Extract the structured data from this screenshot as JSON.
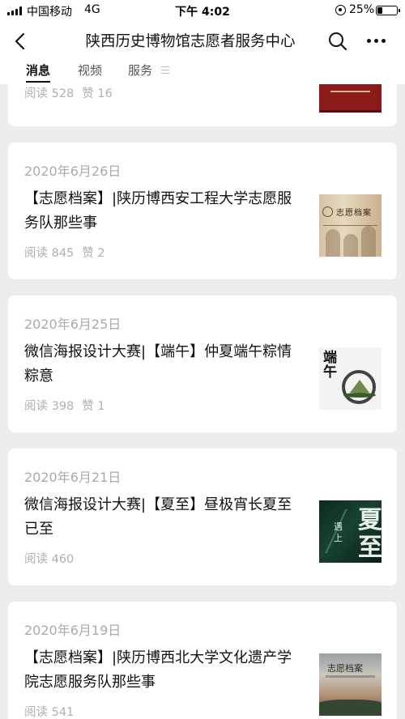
{
  "status_bar": {
    "carrier": "中国移动",
    "network": "4G",
    "time": "下午 4:02",
    "battery_percent": "25%",
    "battery_level": 0.25
  },
  "nav": {
    "title": "陕西历史博物馆志愿者服务中心",
    "back_icon": "chevron-left-icon",
    "search_icon": "search-icon",
    "more_icon": "more-dots-icon"
  },
  "tabs": [
    {
      "label": "消息",
      "active": true
    },
    {
      "label": "视频",
      "active": false
    },
    {
      "label": "服务",
      "active": false
    }
  ],
  "articles": [
    {
      "date": "",
      "title": "",
      "reads": "阅读 528",
      "likes": "赞 16"
    },
    {
      "date": "2020年6月26日",
      "title": "【志愿档案】|陕历博西安工程大学志愿服务队那些事",
      "reads": "阅读 845",
      "likes": "赞 2",
      "thumb_text": "志愿档案"
    },
    {
      "date": "2020年6月25日",
      "title": "微信海报设计大赛|【端午】仲夏端午粽情粽意",
      "reads": "阅读 398",
      "likes": "赞 1",
      "thumb_text": "端午"
    },
    {
      "date": "2020年6月21日",
      "title": "微信海报设计大赛|【夏至】昼极宵长夏至已至",
      "reads": "阅读 460",
      "likes": "",
      "thumb_text": "夏至",
      "thumb_text2": "遇上"
    },
    {
      "date": "2020年6月19日",
      "title": "【志愿档案】|陕历博西北大学文化遗产学院志愿服务队那些事",
      "reads": "阅读 541",
      "likes": "",
      "thumb_text": "志愿档案"
    }
  ]
}
